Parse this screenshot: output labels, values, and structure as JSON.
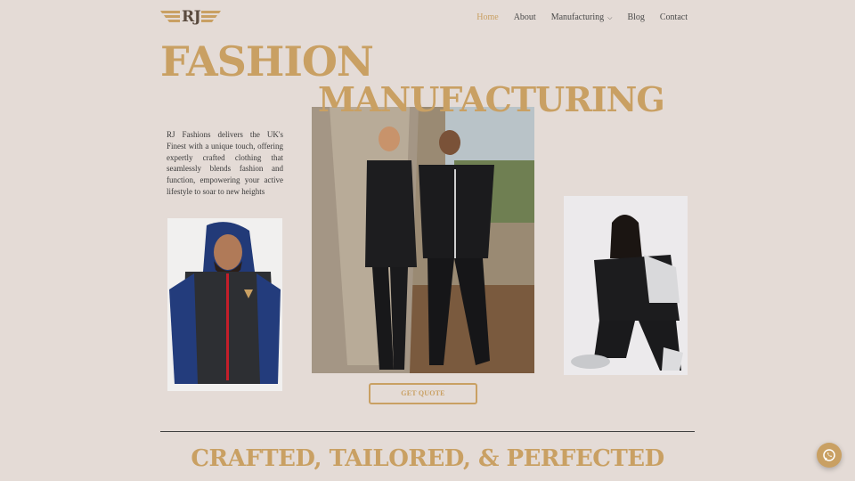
{
  "brand": {
    "logo_text": "RJ"
  },
  "nav": {
    "items": [
      {
        "label": "Home",
        "active": true
      },
      {
        "label": "About"
      },
      {
        "label": "Manufacturing",
        "has_dropdown": true
      },
      {
        "label": "Blog"
      },
      {
        "label": "Contact"
      }
    ]
  },
  "hero": {
    "title_line1": "FASHION",
    "title_line2": "MANUFACTURING",
    "intro": "RJ Fashions delivers the UK's Finest with a unique touch, offering expertly crafted clothing that seamlessly blends fashion and function, empowering your active lifestyle to soar to new heights",
    "cta_label": "GET QUOTE"
  },
  "section": {
    "heading": "CRAFTED, TAILORED, & PERFECTED"
  },
  "colors": {
    "accent": "#c9a063",
    "background": "#e4dbd6",
    "text": "#333333"
  },
  "icons": {
    "whatsapp": "whatsapp-icon",
    "dropdown": "chevron-down-icon"
  }
}
